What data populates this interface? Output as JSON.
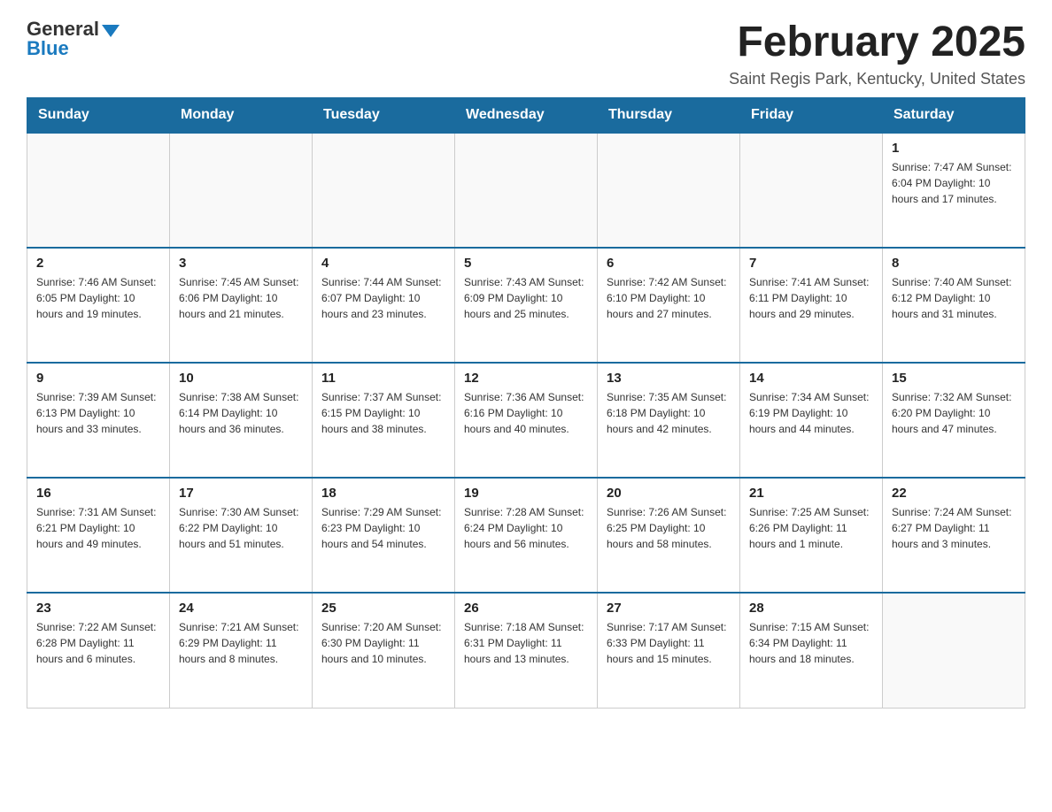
{
  "header": {
    "logo_general": "General",
    "logo_blue": "Blue",
    "month_title": "February 2025",
    "location": "Saint Regis Park, Kentucky, United States"
  },
  "days_of_week": [
    "Sunday",
    "Monday",
    "Tuesday",
    "Wednesday",
    "Thursday",
    "Friday",
    "Saturday"
  ],
  "weeks": [
    [
      {
        "day": "",
        "info": ""
      },
      {
        "day": "",
        "info": ""
      },
      {
        "day": "",
        "info": ""
      },
      {
        "day": "",
        "info": ""
      },
      {
        "day": "",
        "info": ""
      },
      {
        "day": "",
        "info": ""
      },
      {
        "day": "1",
        "info": "Sunrise: 7:47 AM\nSunset: 6:04 PM\nDaylight: 10 hours and 17 minutes."
      }
    ],
    [
      {
        "day": "2",
        "info": "Sunrise: 7:46 AM\nSunset: 6:05 PM\nDaylight: 10 hours and 19 minutes."
      },
      {
        "day": "3",
        "info": "Sunrise: 7:45 AM\nSunset: 6:06 PM\nDaylight: 10 hours and 21 minutes."
      },
      {
        "day": "4",
        "info": "Sunrise: 7:44 AM\nSunset: 6:07 PM\nDaylight: 10 hours and 23 minutes."
      },
      {
        "day": "5",
        "info": "Sunrise: 7:43 AM\nSunset: 6:09 PM\nDaylight: 10 hours and 25 minutes."
      },
      {
        "day": "6",
        "info": "Sunrise: 7:42 AM\nSunset: 6:10 PM\nDaylight: 10 hours and 27 minutes."
      },
      {
        "day": "7",
        "info": "Sunrise: 7:41 AM\nSunset: 6:11 PM\nDaylight: 10 hours and 29 minutes."
      },
      {
        "day": "8",
        "info": "Sunrise: 7:40 AM\nSunset: 6:12 PM\nDaylight: 10 hours and 31 minutes."
      }
    ],
    [
      {
        "day": "9",
        "info": "Sunrise: 7:39 AM\nSunset: 6:13 PM\nDaylight: 10 hours and 33 minutes."
      },
      {
        "day": "10",
        "info": "Sunrise: 7:38 AM\nSunset: 6:14 PM\nDaylight: 10 hours and 36 minutes."
      },
      {
        "day": "11",
        "info": "Sunrise: 7:37 AM\nSunset: 6:15 PM\nDaylight: 10 hours and 38 minutes."
      },
      {
        "day": "12",
        "info": "Sunrise: 7:36 AM\nSunset: 6:16 PM\nDaylight: 10 hours and 40 minutes."
      },
      {
        "day": "13",
        "info": "Sunrise: 7:35 AM\nSunset: 6:18 PM\nDaylight: 10 hours and 42 minutes."
      },
      {
        "day": "14",
        "info": "Sunrise: 7:34 AM\nSunset: 6:19 PM\nDaylight: 10 hours and 44 minutes."
      },
      {
        "day": "15",
        "info": "Sunrise: 7:32 AM\nSunset: 6:20 PM\nDaylight: 10 hours and 47 minutes."
      }
    ],
    [
      {
        "day": "16",
        "info": "Sunrise: 7:31 AM\nSunset: 6:21 PM\nDaylight: 10 hours and 49 minutes."
      },
      {
        "day": "17",
        "info": "Sunrise: 7:30 AM\nSunset: 6:22 PM\nDaylight: 10 hours and 51 minutes."
      },
      {
        "day": "18",
        "info": "Sunrise: 7:29 AM\nSunset: 6:23 PM\nDaylight: 10 hours and 54 minutes."
      },
      {
        "day": "19",
        "info": "Sunrise: 7:28 AM\nSunset: 6:24 PM\nDaylight: 10 hours and 56 minutes."
      },
      {
        "day": "20",
        "info": "Sunrise: 7:26 AM\nSunset: 6:25 PM\nDaylight: 10 hours and 58 minutes."
      },
      {
        "day": "21",
        "info": "Sunrise: 7:25 AM\nSunset: 6:26 PM\nDaylight: 11 hours and 1 minute."
      },
      {
        "day": "22",
        "info": "Sunrise: 7:24 AM\nSunset: 6:27 PM\nDaylight: 11 hours and 3 minutes."
      }
    ],
    [
      {
        "day": "23",
        "info": "Sunrise: 7:22 AM\nSunset: 6:28 PM\nDaylight: 11 hours and 6 minutes."
      },
      {
        "day": "24",
        "info": "Sunrise: 7:21 AM\nSunset: 6:29 PM\nDaylight: 11 hours and 8 minutes."
      },
      {
        "day": "25",
        "info": "Sunrise: 7:20 AM\nSunset: 6:30 PM\nDaylight: 11 hours and 10 minutes."
      },
      {
        "day": "26",
        "info": "Sunrise: 7:18 AM\nSunset: 6:31 PM\nDaylight: 11 hours and 13 minutes."
      },
      {
        "day": "27",
        "info": "Sunrise: 7:17 AM\nSunset: 6:33 PM\nDaylight: 11 hours and 15 minutes."
      },
      {
        "day": "28",
        "info": "Sunrise: 7:15 AM\nSunset: 6:34 PM\nDaylight: 11 hours and 18 minutes."
      },
      {
        "day": "",
        "info": ""
      }
    ]
  ]
}
